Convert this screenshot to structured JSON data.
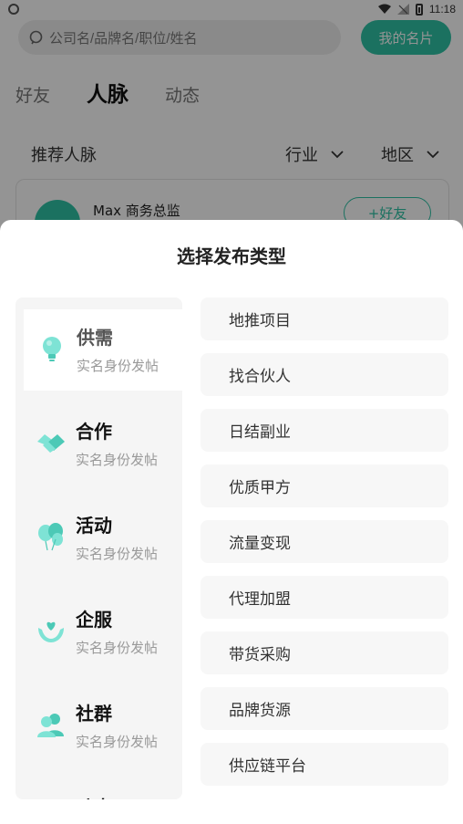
{
  "status_bar": {
    "time": "11:18"
  },
  "search": {
    "placeholder": "公司名/品牌名/职位/姓名"
  },
  "header": {
    "my_card_button": "我的名片"
  },
  "tabs": [
    {
      "label": "好友",
      "active": false
    },
    {
      "label": "人脉",
      "active": true
    },
    {
      "label": "动态",
      "active": false
    }
  ],
  "filter_row": {
    "title": "推荐人脉",
    "industry": "行业",
    "region": "地区"
  },
  "person_card": {
    "name": "Max 商务总监",
    "add_button": "+好友"
  },
  "sheet": {
    "title": "选择发布类型",
    "categories": [
      {
        "name": "供需",
        "sub": "实名身份发帖",
        "icon": "lightbulb-icon",
        "selected": true
      },
      {
        "name": "合作",
        "sub": "实名身份发帖",
        "icon": "handshake-icon",
        "selected": false
      },
      {
        "name": "活动",
        "sub": "实名身份发帖",
        "icon": "balloons-icon",
        "selected": false
      },
      {
        "name": "企服",
        "sub": "实名身份发帖",
        "icon": "heart-hands-icon",
        "selected": false
      },
      {
        "name": "社群",
        "sub": "实名身份发帖",
        "icon": "people-icon",
        "selected": false
      },
      {
        "name": "动态",
        "sub": "",
        "icon": "",
        "selected": false
      }
    ],
    "subcategories": [
      "地推项目",
      "找合伙人",
      "日结副业",
      "优质甲方",
      "流量变现",
      "代理加盟",
      "带货采购",
      "品牌货源",
      "供应链平台"
    ]
  },
  "colors": {
    "accent": "#2fc3a6",
    "icon_light": "#7ee3d5",
    "icon_dark": "#4cc9b6"
  }
}
